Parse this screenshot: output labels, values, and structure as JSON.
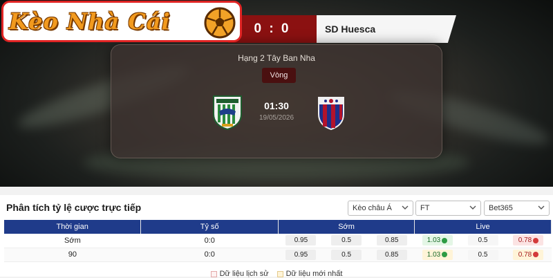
{
  "brand": {
    "logo_text": "Kèo Nhà Cái"
  },
  "match": {
    "score": "0 : 0",
    "away_team": "SD Huesca",
    "league": "Hạng 2 Tây Ban Nha",
    "round_label": "Vòng",
    "kickoff_time": "01:30",
    "date": "19/05/2026",
    "home_crest_icon": "leganes-crest-icon",
    "away_crest_icon": "huesca-crest-icon"
  },
  "odds_panel": {
    "title": "Phân tích tỷ lệ cược trực tiếp",
    "filters": {
      "market": "Kèo châu Á",
      "period": "FT",
      "bookmaker": "Bet365"
    },
    "columns": [
      "Thời gian",
      "Tỷ số",
      "Sớm",
      "Live"
    ],
    "rows": [
      {
        "time": "Sớm",
        "score": "0:0",
        "early": [
          "0.95",
          "0.5",
          "0.85"
        ],
        "live": [
          "1.03",
          "0.5",
          "0.78"
        ]
      },
      {
        "time": "90",
        "score": "0:0",
        "early": [
          "0.95",
          "0.5",
          "0.85"
        ],
        "live": [
          "1.03",
          "0.5",
          "0.78"
        ]
      }
    ],
    "legend": {
      "history": "Dữ liệu lịch sử",
      "latest": "Dữ liệu mới nhất"
    }
  },
  "colors": {
    "score_bg": "#8b1111",
    "table_header": "#1f3b8a",
    "logo_text": "#f29a1e",
    "logo_border": "#e02424"
  }
}
